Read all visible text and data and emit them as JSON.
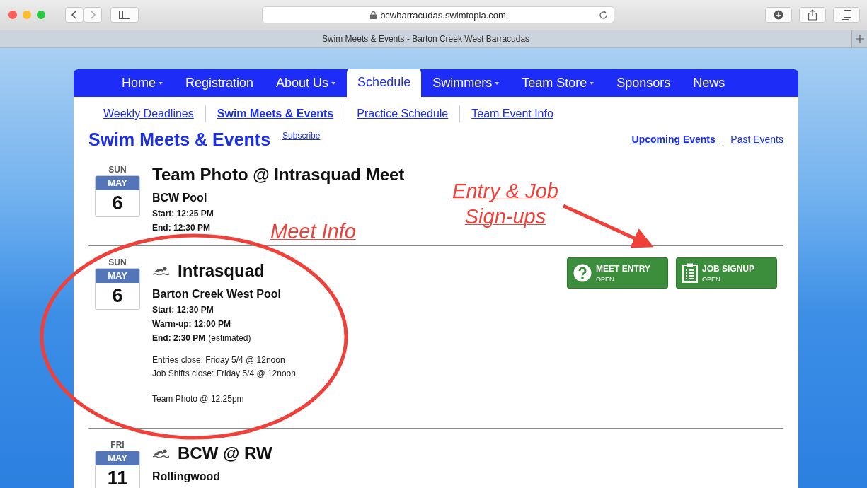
{
  "browser": {
    "url": "bcwbarracudas.swimtopia.com",
    "tab_title": "Swim Meets & Events - Barton Creek West Barracudas"
  },
  "nav": [
    {
      "label": "Home",
      "has_menu": true,
      "selected": false
    },
    {
      "label": "Registration",
      "has_menu": false,
      "selected": false
    },
    {
      "label": "About Us",
      "has_menu": true,
      "selected": false
    },
    {
      "label": "Schedule",
      "has_menu": false,
      "selected": true
    },
    {
      "label": "Swimmers",
      "has_menu": true,
      "selected": false
    },
    {
      "label": "Team Store",
      "has_menu": true,
      "selected": false
    },
    {
      "label": "Sponsors",
      "has_menu": false,
      "selected": false
    },
    {
      "label": "News",
      "has_menu": false,
      "selected": false
    }
  ],
  "subnav": [
    {
      "label": "Weekly Deadlines",
      "selected": false
    },
    {
      "label": "Swim Meets & Events",
      "selected": true
    },
    {
      "label": "Practice Schedule",
      "selected": false
    },
    {
      "label": "Team Event Info",
      "selected": false
    }
  ],
  "heading": {
    "title": "Swim Meets & Events",
    "subscribe": "Subscribe"
  },
  "filters": [
    {
      "label": "Upcoming Events",
      "selected": true
    },
    {
      "label": "Past Events",
      "selected": false
    }
  ],
  "events": [
    {
      "kind": "event",
      "dow": "SUN",
      "month": "MAY",
      "day": "6",
      "title": "Team Photo @ Intrasquad Meet",
      "location": "BCW Pool",
      "times": [
        {
          "label": "Start: 12:25 PM"
        },
        {
          "label": "End: 12:30 PM"
        }
      ]
    },
    {
      "kind": "meet",
      "dow": "SUN",
      "month": "MAY",
      "day": "6",
      "title": "Intrasquad",
      "location": "Barton Creek West Pool",
      "times": [
        {
          "label": "Start: 12:30 PM"
        },
        {
          "label": "Warm-up: 12:00 PM"
        },
        {
          "label": "End: 2:30 PM",
          "note": "(estimated)"
        }
      ],
      "notes": [
        [
          "Entries close: Friday 5/4 @ 12noon",
          "Job Shifts close: Friday 5/4 @ 12noon"
        ],
        [
          "Team Photo @ 12:25pm"
        ]
      ],
      "buttons": [
        {
          "kind": "question",
          "label": "MEET ENTRY",
          "status": "OPEN"
        },
        {
          "kind": "clipboard",
          "label": "JOB SIGNUP",
          "status": "OPEN"
        }
      ]
    },
    {
      "kind": "meet",
      "dow": "FRI",
      "month": "MAY",
      "day": "11",
      "title": "BCW @ RW",
      "location": "Rollingwood"
    }
  ],
  "annotations": [
    {
      "kind": "label",
      "text": "Meet Info"
    },
    {
      "kind": "label",
      "text": "Entry & Job Sign-ups"
    }
  ]
}
